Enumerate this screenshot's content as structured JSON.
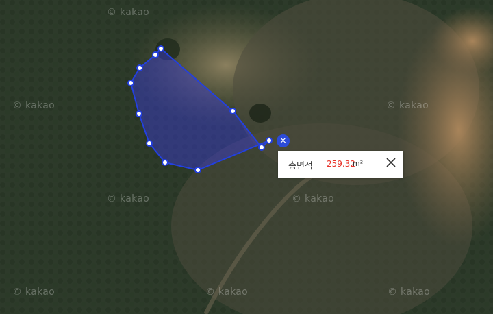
{
  "map": {
    "watermark_text": "© kakao",
    "polygon_color": "#2340e0",
    "vertices": 12
  },
  "measure": {
    "close_marker_icon": "×",
    "label": "총면적",
    "value": "259.32",
    "unit": "m²",
    "value_color": "#e8352b"
  }
}
